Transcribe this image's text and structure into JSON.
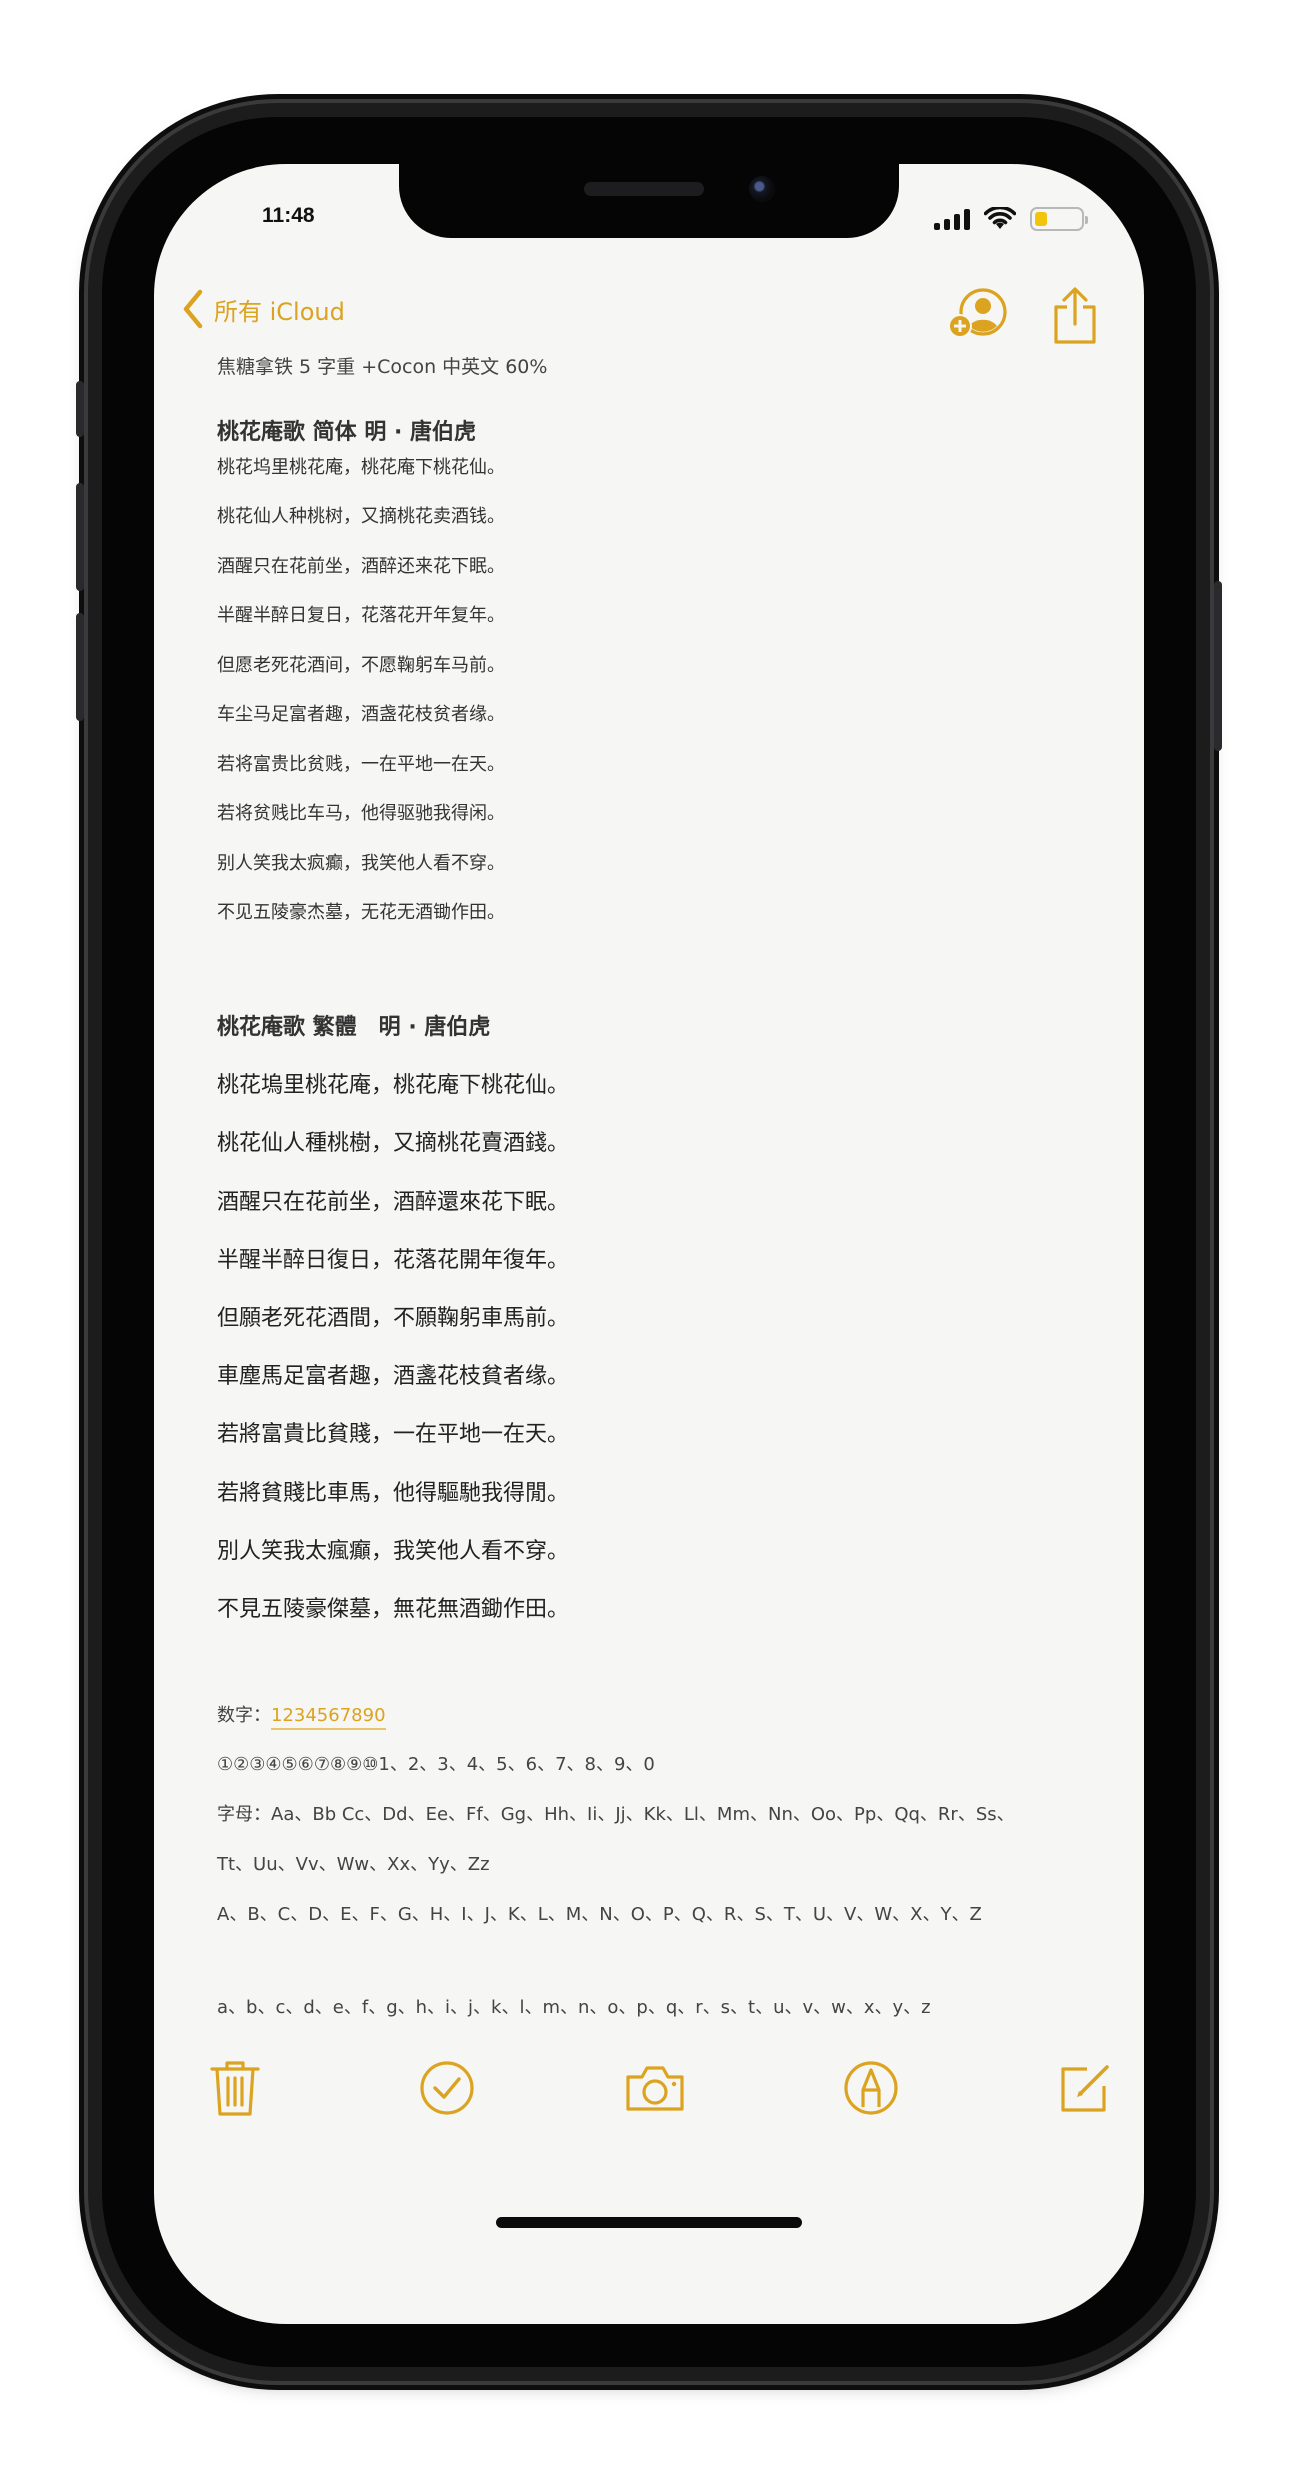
{
  "status": {
    "time": "11:48"
  },
  "nav": {
    "back_label": "所有 iCloud",
    "add_person_icon": "person-add-icon",
    "share_icon": "share-icon"
  },
  "note": {
    "meta": "焦糖拿铁 5 字重 +Cocon 中英文 60%",
    "section_simplified": {
      "title": "桃花庵歌 简体 明 · 唐伯虎",
      "lines": [
        "桃花坞里桃花庵，桃花庵下桃花仙。",
        "桃花仙人种桃树，又摘桃花卖酒钱。",
        "酒醒只在花前坐，酒醉还来花下眠。",
        "半醒半醉日复日，花落花开年复年。",
        "但愿老死花酒间，不愿鞠躬车马前。",
        "车尘马足富者趣，酒盏花枝贫者缘。",
        "若将富贵比贫贱，一在平地一在天。",
        "若将贫贱比车马，他得驱驰我得闲。",
        "别人笑我太疯癫，我笑他人看不穿。",
        "不见五陵豪杰墓，无花无酒锄作田。"
      ]
    },
    "section_traditional": {
      "title": "桃花庵歌 繁體　明 · 唐伯虎",
      "lines": [
        "桃花塢里桃花庵，桃花庵下桃花仙。",
        "桃花仙人種桃樹，又摘桃花賣酒錢。",
        "酒醒只在花前坐，酒醉還來花下眠。",
        "半醒半醉日復日，花落花開年復年。",
        "但願老死花酒間，不願鞠躬車馬前。",
        "車塵馬足富者趣，酒盞花枝貧者缘。",
        "若將富貴比貧賤，一在平地一在天。",
        "若將貧賤比車馬，他得驅馳我得閒。",
        "別人笑我太瘋癲，我笑他人看不穿。",
        "不見五陵豪傑墓，無花無酒鋤作田。"
      ]
    },
    "numbers_label": "数字：",
    "numbers_link": "1234567890",
    "circled_line": "①②③④⑤⑥⑦⑧⑨⑩1、2、3、4、5、6、7、8、9、0",
    "letters_line_1": "字母：Aa、Bb Cc、Dd、Ee、Ff、Gg、Hh、Ii、Jj、Kk、Ll、Mm、Nn、Oo、Pp、Qq、Rr、Ss、",
    "letters_line_2": "Tt、Uu、Vv、Ww、Xx、Yy、Zz",
    "uppercase_line": "A、B、C、D、E、F、G、H、I、J、K、L、M、N、O、P、Q、R、S、T、U、V、W、X、Y、Z",
    "lowercase_line": "a、b、c、d、e、f、g、h、i、j、k、l、m、n、o、p、q、r、s、t、u、v、w、x、y、z"
  },
  "toolbar": {
    "icons": [
      "trash-icon",
      "checklist-icon",
      "camera-icon",
      "markup-icon",
      "compose-icon"
    ]
  },
  "colors": {
    "accent": "#dba31f",
    "paper": "#f6f6f4",
    "text": "#333333",
    "battery": "#f2c40c"
  }
}
